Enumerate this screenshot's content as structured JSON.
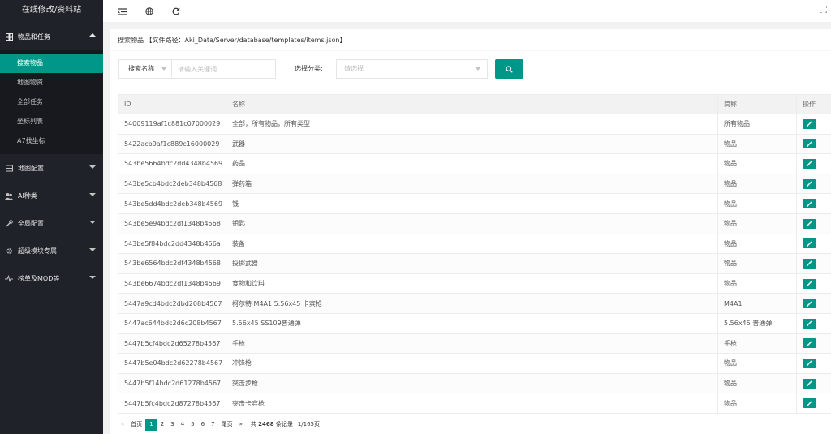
{
  "sidebar": {
    "logo": "在线修改/资料站",
    "groups": [
      {
        "label": "物品和任务",
        "icon": "items-icon"
      },
      {
        "label": "地图配置",
        "icon": "map-icon"
      },
      {
        "label": "AI种类",
        "icon": "users-icon"
      },
      {
        "label": "全局配置",
        "icon": "wrench-icon"
      },
      {
        "label": "超级模块专属",
        "icon": "gear-icon"
      },
      {
        "label": "榜单及MOD等",
        "icon": "pulse-icon"
      }
    ],
    "subitems": [
      "搜索物品",
      "地图物资",
      "全部任务",
      "坐标列表",
      "A7找坐标"
    ]
  },
  "page": {
    "header": "搜索物品 【文件路径：Aki_Data/Server/database/templates/items.json】"
  },
  "search": {
    "field_select": "搜索名称",
    "keyword_placeholder": "请输入关键词",
    "category_label": "选择分类:",
    "category_placeholder": "请选择"
  },
  "table": {
    "columns": [
      "ID",
      "名称",
      "简称",
      "操作"
    ],
    "rows": [
      {
        "id": "54009119af1c881c07000029",
        "name": "全部，所有物品，所有类型",
        "short": "所有物品"
      },
      {
        "id": "5422acb9af1c889c16000029",
        "name": "武器",
        "short": "物品"
      },
      {
        "id": "543be5664bdc2dd4348b4569",
        "name": "药品",
        "short": "物品"
      },
      {
        "id": "543be5cb4bdc2deb348b4568",
        "name": "弹药箱",
        "short": "物品"
      },
      {
        "id": "543be5dd4bdc2deb348b4569",
        "name": "钱",
        "short": "物品"
      },
      {
        "id": "543be5e94bdc2df1348b4568",
        "name": "钥匙",
        "short": "物品"
      },
      {
        "id": "543be5f84bdc2dd4348b456a",
        "name": "装备",
        "short": "物品"
      },
      {
        "id": "543be6564bdc2df4348b4568",
        "name": "投掷武器",
        "short": "物品"
      },
      {
        "id": "543be6674bdc2df1348b4569",
        "name": "食物和饮料",
        "short": "物品"
      },
      {
        "id": "5447a9cd4bdc2dbd208b4567",
        "name": "柯尔特 M4A1 5.56x45 卡宾枪",
        "short": "M4A1"
      },
      {
        "id": "5447ac644bdc2d6c208b4567",
        "name": "5.56x45 SS109普通弹",
        "short": "5.56x45 普通弹"
      },
      {
        "id": "5447b5cf4bdc2d65278b4567",
        "name": "手枪",
        "short": "手枪"
      },
      {
        "id": "5447b5e04bdc2d62278b4567",
        "name": "冲锋枪",
        "short": "物品"
      },
      {
        "id": "5447b5f14bdc2d61278b4567",
        "name": "突击步枪",
        "short": "物品"
      },
      {
        "id": "5447b5fc4bdc2d87278b4567",
        "name": "突击卡宾枪",
        "short": "物品"
      }
    ]
  },
  "pager": {
    "first": "首页",
    "pages": [
      "1",
      "2",
      "3",
      "4",
      "5",
      "6",
      "7"
    ],
    "current": "1",
    "last": "尾页",
    "total_prefix": "共",
    "total_count": "2468",
    "total_suffix": "条记录",
    "page_info": "1/165页"
  },
  "colors": {
    "accent": "#009688",
    "sidebar_bg": "#20222a"
  }
}
